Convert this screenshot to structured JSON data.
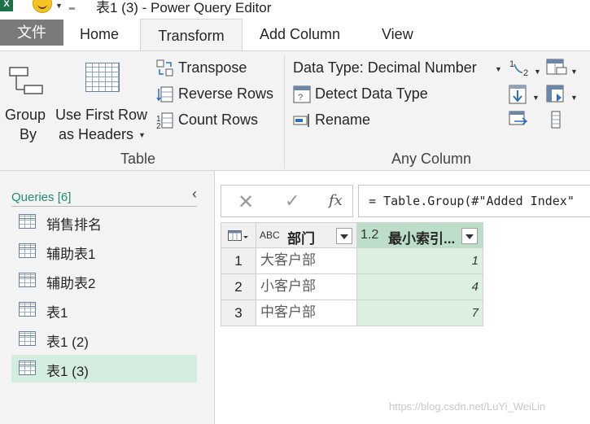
{
  "titlebar": {
    "excel_badge": "X",
    "title": "表1 (3) - Power Query Editor"
  },
  "tabs": [
    {
      "label": "文件"
    },
    {
      "label": "Home"
    },
    {
      "label": "Transform"
    },
    {
      "label": "Add Column"
    },
    {
      "label": "View"
    }
  ],
  "ribbon": {
    "table_group": {
      "label": "Table",
      "group_by": [
        "Group",
        "By"
      ],
      "use_first_row": [
        "Use First Row",
        "as Headers"
      ],
      "transpose": "Transpose",
      "reverse_rows": "Reverse Rows",
      "count_rows": "Count Rows"
    },
    "any_column_group": {
      "label": "Any Column",
      "data_type": "Data Type: Decimal Number",
      "detect_data_type": "Detect Data Type",
      "rename": "Rename",
      "replace_values_sub": "2"
    }
  },
  "queries": {
    "header": "Queries [6]",
    "items": [
      {
        "label": "销售排名"
      },
      {
        "label": "辅助表1"
      },
      {
        "label": "辅助表2"
      },
      {
        "label": "表1"
      },
      {
        "label": "表1 (2)"
      },
      {
        "label": "表1 (3)"
      }
    ],
    "selected_index": 5
  },
  "formula_bar": {
    "fx": "fx",
    "formula": "= Table.Group(#\"Added Index\""
  },
  "table": {
    "columns": [
      {
        "type_icon": "ABC",
        "name": "部门"
      },
      {
        "type_icon": "1.2",
        "name": "最小索引..."
      }
    ],
    "rows": [
      {
        "num": "1",
        "dept": "大客户部",
        "min_index": "1"
      },
      {
        "num": "2",
        "dept": "小客户部",
        "min_index": "4"
      },
      {
        "num": "3",
        "dept": "中客户部",
        "min_index": "7"
      }
    ]
  },
  "watermark": "https://blog.csdn.net/LuYi_WeiLin",
  "colors": {
    "accent_green": "#1f8e6f",
    "selected_bg": "#d5eddf",
    "number_col_bg": "#dcf0e2",
    "file_tab_bg": "#7a7a7a"
  }
}
